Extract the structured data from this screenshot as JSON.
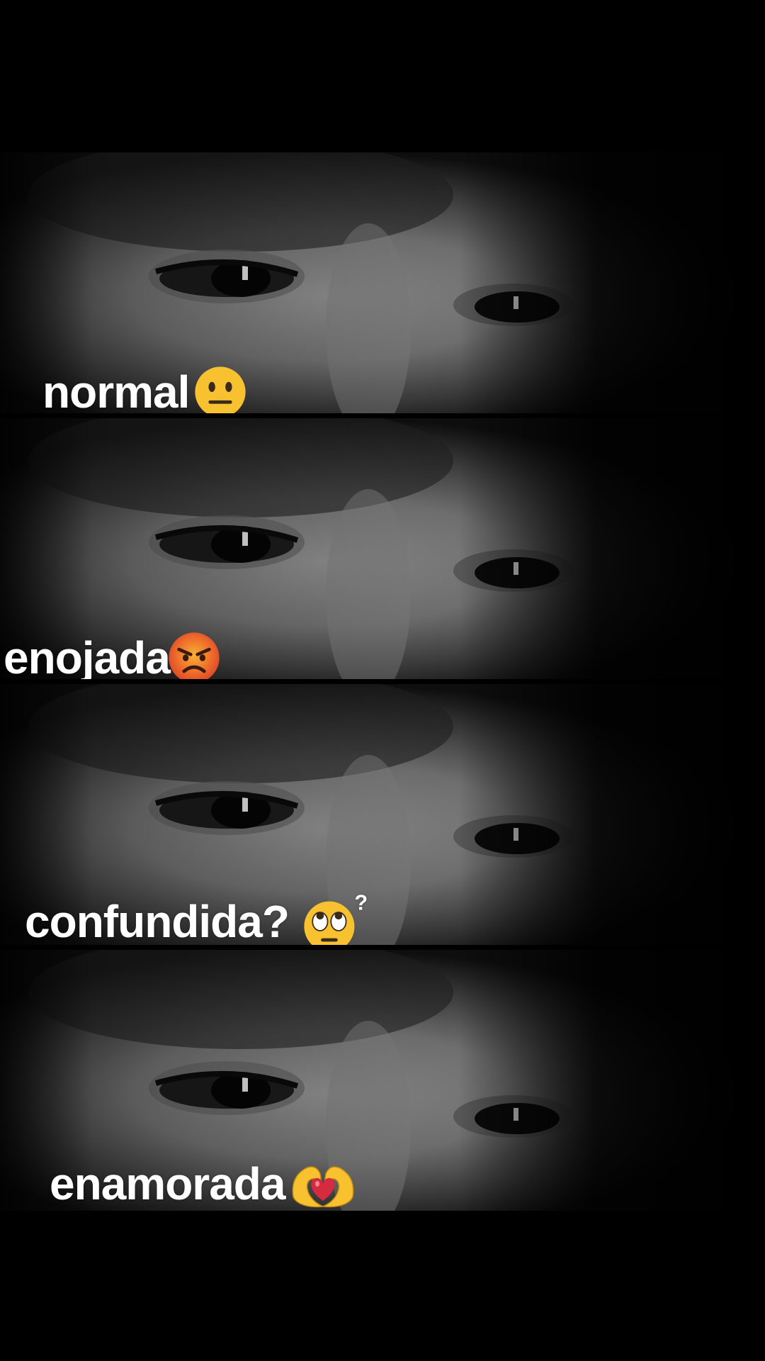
{
  "panels": [
    {
      "caption": "normal",
      "emoji": "neutral-face-emoji"
    },
    {
      "caption": "enojada",
      "emoji": "angry-face-emoji"
    },
    {
      "caption": "confundida?",
      "emoji": "rolling-eyes-question-emoji"
    },
    {
      "caption": "enamorada",
      "emoji": "heart-hands-emoji"
    }
  ],
  "colors": {
    "background": "#000000",
    "caption_text": "#ffffff",
    "emoji_yellow": "#f7c12f",
    "angry_red": "#e8502a",
    "heart_red": "#d62a3e"
  }
}
